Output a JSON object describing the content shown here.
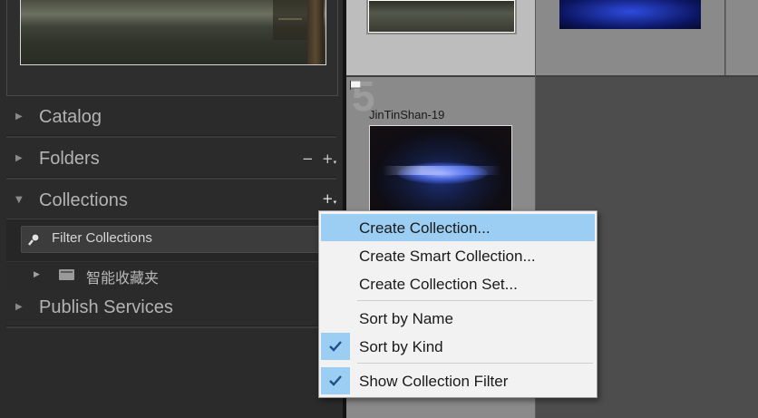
{
  "left_panel": {
    "sections": {
      "catalog": {
        "label": "Catalog",
        "expanded": false
      },
      "folders": {
        "label": "Folders",
        "expanded": false,
        "minus": "−",
        "plus": "+"
      },
      "collections": {
        "label": "Collections",
        "expanded": true,
        "plus": "+"
      },
      "publish_services": {
        "label": "Publish Services",
        "expanded": false
      }
    },
    "collections": {
      "filter_label": "Filter Collections",
      "items": [
        {
          "label": "智能收藏夹",
          "kind": "smart-collection-set"
        }
      ]
    },
    "glyphs": {
      "collapsed": "▶",
      "expanded": "▼",
      "caret": "▾"
    }
  },
  "grid": {
    "selected_cell": {
      "index": "5",
      "filename": "JinTinShan-19"
    }
  },
  "context_menu": {
    "items": [
      {
        "label": "Create Collection...",
        "highlighted": true
      },
      {
        "label": "Create Smart Collection..."
      },
      {
        "label": "Create Collection Set..."
      },
      {
        "label": "Sort by Name",
        "checked": false
      },
      {
        "label": "Sort by Kind",
        "checked": true
      },
      {
        "label": "Show Collection Filter",
        "checked": true
      }
    ]
  },
  "colors": {
    "panel_bg": "#2b2b2b",
    "grid_bg": "#4d4d4d",
    "menu_highlight": "#9ccdf2",
    "check_color": "#1f4f8a"
  }
}
